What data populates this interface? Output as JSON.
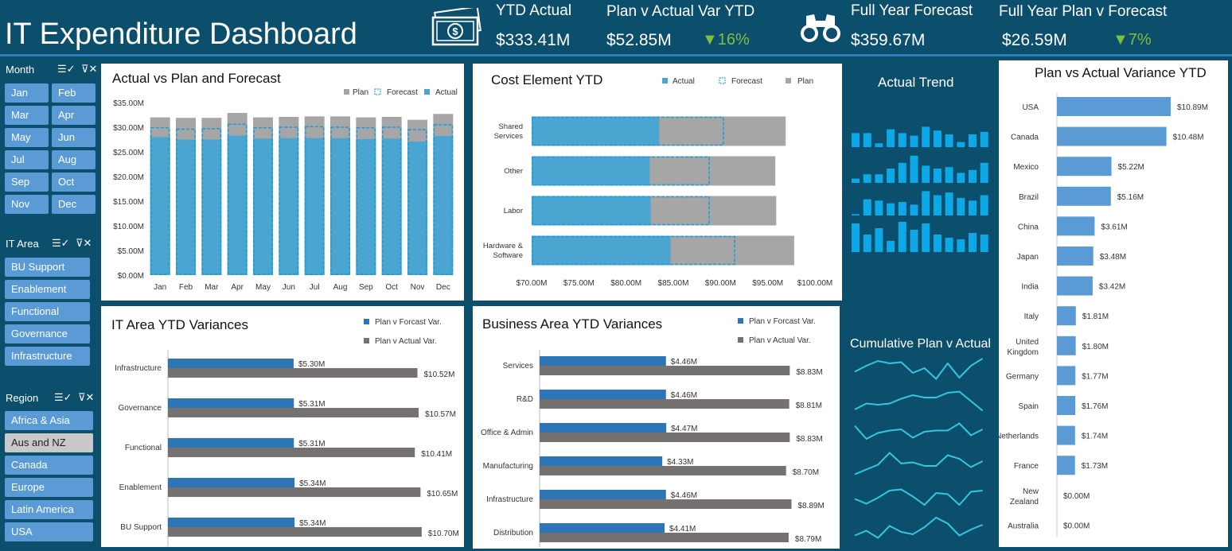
{
  "header": {
    "title": "IT Expenditure Dashboard",
    "kpis": [
      {
        "label": "YTD Actual",
        "value": "$333.41M"
      },
      {
        "label": "Plan v Actual Var YTD",
        "value": "$52.85M",
        "var": "▼16%"
      },
      {
        "label": "Full Year Forecast",
        "value": "$359.67M"
      },
      {
        "label": "Full Year Plan v Forecast",
        "value": "$26.59M",
        "var": "▼7%"
      }
    ]
  },
  "slicers": {
    "month": {
      "title": "Month",
      "items": [
        "Jan",
        "Feb",
        "Mar",
        "Apr",
        "May",
        "Jun",
        "Jul",
        "Aug",
        "Sep",
        "Oct",
        "Nov",
        "Dec"
      ]
    },
    "itarea": {
      "title": "IT Area",
      "items": [
        "BU Support",
        "Enablement",
        "Functional",
        "Governance",
        "Infrastructure"
      ]
    },
    "region": {
      "title": "Region",
      "items": [
        "Africa & Asia",
        "Aus and NZ",
        "Canada",
        "Europe",
        "Latin America",
        "USA"
      ],
      "selected": "Aus and NZ"
    }
  },
  "colors": {
    "plan": "#a6a6a6",
    "actual": "#4aa6d0",
    "forecast_border": "#1b9ad6",
    "blue_bar": "#2e75b6",
    "grey_bar": "#757171",
    "country_bar": "#5b9bd5",
    "spark_bar": "#0da8e8",
    "spark_line": "#33c6e0"
  },
  "charts": {
    "avp": {
      "title": "Actual vs Plan and Forecast",
      "legend": [
        "Plan",
        "Forecast",
        "Actual"
      ],
      "chart_data": {
        "type": "bar",
        "categories": [
          "Jan",
          "Feb",
          "Mar",
          "Apr",
          "May",
          "Jun",
          "Jul",
          "Aug",
          "Sep",
          "Oct",
          "Nov",
          "Dec"
        ],
        "ylim": [
          0,
          35
        ],
        "yticks": [
          "$0.00M",
          "$5.00M",
          "$10.00M",
          "$15.00M",
          "$20.00M",
          "$25.00M",
          "$30.00M",
          "$35.00M"
        ],
        "series": [
          {
            "name": "Plan",
            "values": [
              32.0,
              31.9,
              31.9,
              32.9,
              32.0,
              32.1,
              32.2,
              32.2,
              32.0,
              32.1,
              31.5,
              32.7
            ]
          },
          {
            "name": "Forecast",
            "values": [
              29.9,
              29.6,
              29.7,
              30.6,
              29.9,
              30.0,
              30.1,
              30.0,
              29.9,
              30.0,
              29.5,
              30.5
            ]
          },
          {
            "name": "Actual",
            "values": [
              28.0,
              27.5,
              27.5,
              28.3,
              27.7,
              27.8,
              27.8,
              27.8,
              27.6,
              27.7,
              27.1,
              28.2
            ]
          }
        ]
      }
    },
    "cost": {
      "title": "Cost Element YTD",
      "legend": [
        "Actual",
        "Forecast",
        "Plan"
      ],
      "chart_data": {
        "type": "bar",
        "orientation": "horizontal",
        "categories": [
          "Shared Services",
          "Other",
          "Labor",
          "Hardware & Software"
        ],
        "xlim": [
          70,
          100
        ],
        "xticks": [
          "$70.00M",
          "$75.00M",
          "$80.00M",
          "$85.00M",
          "$90.00M",
          "$95.00M",
          "$100.00M"
        ],
        "series": [
          {
            "name": "Actual",
            "values": [
              83.5,
              82.5,
              82.6,
              84.7
            ]
          },
          {
            "name": "Forecast",
            "values": [
              90.3,
              88.8,
              88.8,
              91.5
            ]
          },
          {
            "name": "Plan",
            "values": [
              96.9,
              95.8,
              95.9,
              97.8
            ]
          }
        ]
      }
    },
    "itarea": {
      "title": "IT Area YTD Variances",
      "legend": [
        "Plan v Forcast Var.",
        "Plan v Actual Var."
      ],
      "chart_data": {
        "type": "bar",
        "orientation": "horizontal",
        "categories": [
          "Infrastructure",
          "Governance",
          "Functional",
          "Enablement",
          "BU Support"
        ],
        "series": [
          {
            "name": "Plan v Forcast Var.",
            "values": [
              5.3,
              5.31,
              5.31,
              5.34,
              5.34
            ],
            "labels": [
              "$5.30M",
              "$5.31M",
              "$5.31M",
              "$5.34M",
              "$5.34M"
            ]
          },
          {
            "name": "Plan v Actual Var.",
            "values": [
              10.52,
              10.57,
              10.41,
              10.65,
              10.7
            ],
            "labels": [
              "$10.52M",
              "$10.57M",
              "$10.41M",
              "$10.65M",
              "$10.70M"
            ]
          }
        ]
      }
    },
    "bizarea": {
      "title": "Business Area YTD Variances",
      "legend": [
        "Plan v Forcast Var.",
        "Plan v Actual Var."
      ],
      "chart_data": {
        "type": "bar",
        "orientation": "horizontal",
        "categories": [
          "Services",
          "R&D",
          "Office & Admin",
          "Manufacturing",
          "Infrastructure",
          "Distribution"
        ],
        "series": [
          {
            "name": "Plan v Forcast Var.",
            "values": [
              4.46,
              4.46,
              4.47,
              4.33,
              4.46,
              4.41
            ],
            "labels": [
              "$4.46M",
              "$4.46M",
              "$4.47M",
              "$4.33M",
              "$4.46M",
              "$4.41M"
            ]
          },
          {
            "name": "Plan v Actual Var.",
            "values": [
              8.83,
              8.81,
              8.83,
              8.7,
              8.89,
              8.79
            ],
            "labels": [
              "$8.83M",
              "$8.81M",
              "$8.83M",
              "$8.70M",
              "$8.89M",
              "$8.79M"
            ]
          }
        ]
      }
    },
    "trend": {
      "title": "Actual Trend",
      "chart_data": {
        "type": "bar",
        "series": [
          {
            "values": [
              0.55,
              0.55,
              0.15,
              0.7,
              0.55,
              0.45,
              0.8,
              0.65,
              0.5,
              0.2,
              0.5,
              0.6
            ]
          },
          {
            "values": [
              0.15,
              0.3,
              0.3,
              0.5,
              0.7,
              0.95,
              0.6,
              0.5,
              0.55,
              0.35,
              0.45,
              0.7
            ]
          },
          {
            "values": [
              0.05,
              0.6,
              0.55,
              0.45,
              0.5,
              0.4,
              0.9,
              0.75,
              0.85,
              0.65,
              0.55,
              0.75
            ]
          },
          {
            "values": [
              0.9,
              0.55,
              0.75,
              0.35,
              0.95,
              0.7,
              0.9,
              0.55,
              0.45,
              0.4,
              0.6,
              0.55
            ]
          }
        ]
      }
    },
    "cumulative": {
      "title": "Cumulative Plan v Actual",
      "chart_data": {
        "type": "line",
        "series": [
          {
            "values": [
              0.35,
              0.6,
              0.8,
              0.7,
              0.75,
              0.3,
              0.5,
              0.05,
              0.7,
              0.1,
              0.6,
              0.9
            ]
          },
          {
            "values": [
              0.1,
              0.35,
              0.3,
              0.35,
              0.55,
              0.7,
              0.6,
              0.6,
              0.8,
              0.85,
              0.45,
              0.05
            ]
          },
          {
            "values": [
              0.75,
              0.2,
              0.45,
              0.55,
              0.6,
              0.25,
              0.5,
              0.55,
              0.55,
              0.85,
              0.35,
              0.6
            ]
          },
          {
            "values": [
              0.05,
              0.25,
              0.45,
              0.95,
              0.5,
              0.55,
              0.4,
              0.4,
              0.85,
              0.7,
              0.35,
              0.6
            ]
          },
          {
            "values": [
              0.35,
              0.15,
              0.4,
              0.7,
              0.75,
              0.45,
              0.1,
              0.6,
              0.55,
              0.1,
              0.65,
              0.7
            ]
          },
          {
            "values": [
              0.15,
              0.35,
              0.05,
              0.55,
              0.3,
              0.2,
              0.5,
              0.9,
              0.65,
              0.15,
              0.4,
              0.6
            ]
          }
        ]
      }
    },
    "country": {
      "title": "Plan vs Actual Variance YTD",
      "chart_data": {
        "type": "bar",
        "orientation": "horizontal",
        "categories": [
          "USA",
          "Canada",
          "Mexico",
          "Brazil",
          "China",
          "Japan",
          "India",
          "Italy",
          "United Kingdom",
          "Germany",
          "Spain",
          "Netherlands",
          "France",
          "New Zealand",
          "Australia"
        ],
        "values": [
          10.89,
          10.48,
          5.22,
          5.16,
          3.61,
          3.48,
          3.42,
          1.81,
          1.8,
          1.77,
          1.76,
          1.74,
          1.73,
          0.0,
          0.0
        ],
        "labels": [
          "$10.89M",
          "$10.48M",
          "$5.22M",
          "$5.16M",
          "$3.61M",
          "$3.48M",
          "$3.42M",
          "$1.81M",
          "$1.80M",
          "$1.77M",
          "$1.76M",
          "$1.74M",
          "$1.73M",
          "$0.00M",
          "$0.00M"
        ]
      }
    }
  }
}
